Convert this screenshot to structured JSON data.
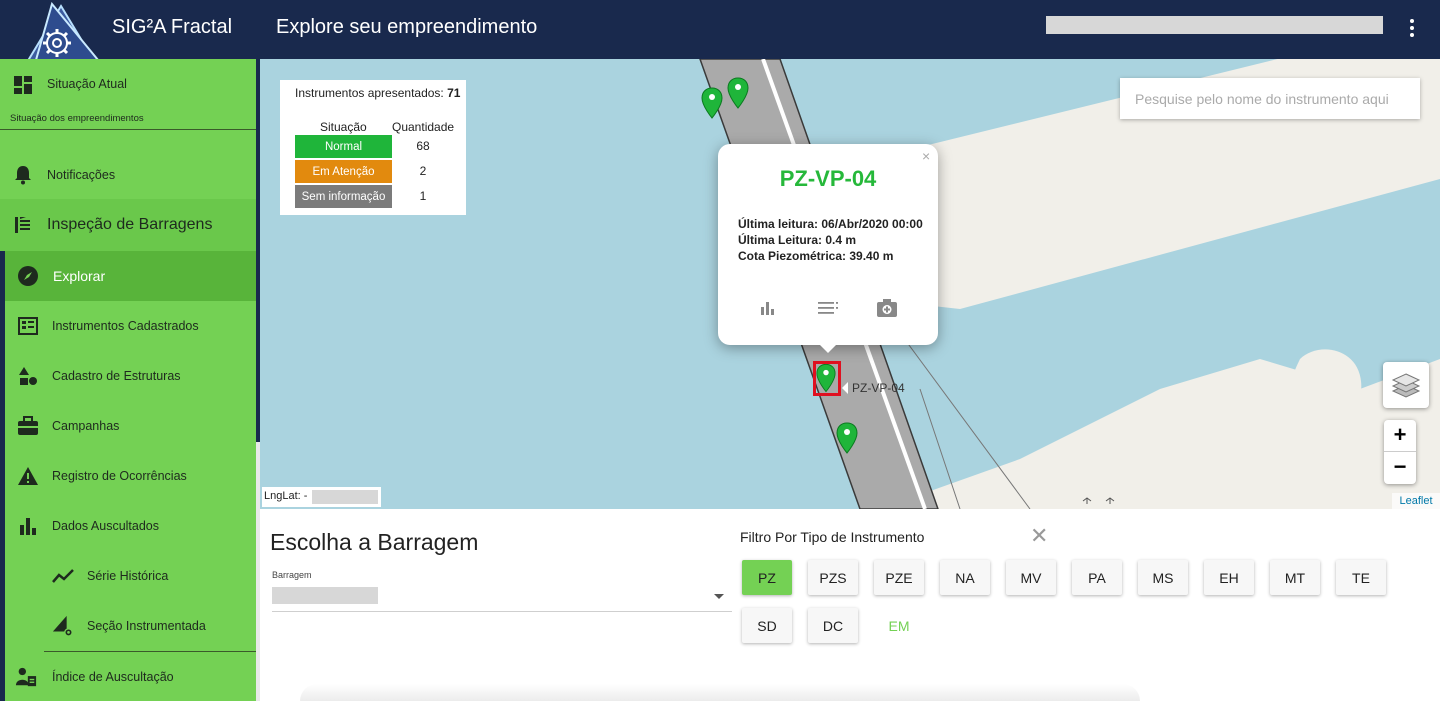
{
  "header": {
    "app_title": "SIG²A Fractal",
    "page_title": "Explore seu empreendimento",
    "menu_icon": "kebab-menu-icon"
  },
  "sidebar": {
    "situacao_atual": {
      "label": "Situação Atual",
      "subtitle": "Situação dos empreendimentos",
      "icon": "dashboard-icon"
    },
    "notificacoes": {
      "label": "Notificações",
      "icon": "bell-icon"
    },
    "inspecao": {
      "label": "Inspeção de Barragens",
      "icon": "inspection-icon"
    },
    "explorar": {
      "label": "Explorar",
      "icon": "compass-icon"
    },
    "items": [
      {
        "label": "Instrumentos Cadastrados",
        "icon": "instruments-icon"
      },
      {
        "label": "Cadastro de Estruturas",
        "icon": "shapes-icon"
      },
      {
        "label": "Campanhas",
        "icon": "briefcase-icon"
      },
      {
        "label": "Registro de Ocorrências",
        "icon": "warning-icon"
      },
      {
        "label": "Dados Auscultados",
        "icon": "bar-chart-icon"
      },
      {
        "label": "Série Histórica",
        "icon": "line-chart-icon"
      },
      {
        "label": "Seção Instrumentada",
        "icon": "section-gear-icon"
      },
      {
        "label": "Índice de Auscultação",
        "icon": "user-index-icon"
      }
    ]
  },
  "legend": {
    "title": "Instrumentos apresentados:",
    "total": "71",
    "col_situacao": "Situação",
    "col_quantidade": "Quantidade",
    "rows": [
      {
        "label": "Normal",
        "qty": "68",
        "color": "#1fb53a"
      },
      {
        "label": "Em Atenção",
        "qty": "2",
        "color": "#e28a0e"
      },
      {
        "label": "Sem informação",
        "qty": "1",
        "color": "#7b7b7b"
      }
    ]
  },
  "search": {
    "placeholder": "Pesquise pelo nome do instrumento aqui"
  },
  "popup": {
    "title": "PZ-VP-04",
    "close": "×",
    "lines": [
      "Última leitura: 06/Abr/2020 00:00",
      "Última Leitura: 0.4 m",
      "Cota Piezométrica: 39.40 m"
    ],
    "actions": [
      "chart-icon",
      "list-icon",
      "add-photo-icon"
    ]
  },
  "map": {
    "selected_label": "PZ-VP-04",
    "lnglat_label": "LngLat: -",
    "zoom_in": "+",
    "zoom_out": "−",
    "attribution": "Leaflet",
    "layers_icon": "layers-icon",
    "marker_color": "#1fb53a"
  },
  "barragem": {
    "title": "Escolha a Barragem",
    "field_label": "Barragem"
  },
  "filter": {
    "title": "Filtro Por Tipo de Instrumento",
    "close": "✕",
    "chips": [
      "PZ",
      "PZS",
      "PZE",
      "NA",
      "MV",
      "PA",
      "MS",
      "EH",
      "MT",
      "TE",
      "SD",
      "DC",
      "EM"
    ],
    "active": "PZ"
  },
  "colors": {
    "header": "#19294d",
    "sidebar": "#74d154",
    "accent": "#1fb53a",
    "water": "#aad3df"
  }
}
